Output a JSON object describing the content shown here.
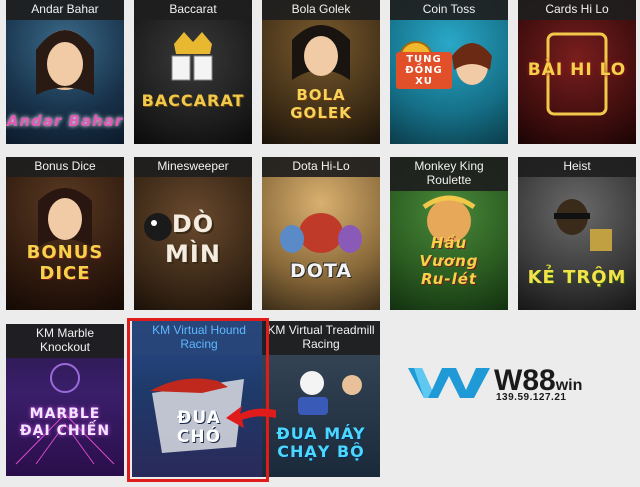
{
  "games": [
    {
      "label": "Andar Bahar",
      "logo": "Andar Bahar"
    },
    {
      "label": "Baccarat",
      "logo": "BACCARAT"
    },
    {
      "label": "Bola Golek",
      "logo": "BOLA GOLEK"
    },
    {
      "label": "Coin Toss",
      "logo": "TUNG ĐỒNG XU"
    },
    {
      "label": "Cards Hi Lo",
      "logo": "BÀI HI LO"
    },
    {
      "label": "Bonus Dice",
      "logo": "BONUS DICE"
    },
    {
      "label": "Minesweeper",
      "logo": "DÒ MÌN"
    },
    {
      "label": "Dota Hi-Lo",
      "logo": "DOTA"
    },
    {
      "label": "Monkey King Roulette",
      "logo": "Hầu Vương Ru-lét"
    },
    {
      "label": "Heist",
      "logo": "KẺ TRỘM"
    },
    {
      "label": "KM Marble Knockout",
      "logo": "MARBLE ĐẠI CHIẾN"
    },
    {
      "label": "KM Virtual Hound Racing",
      "logo": "ĐUA CHÓ"
    },
    {
      "label": "KM Virtual Treadmill Racing",
      "logo": "ĐUA MÁY CHẠY BỘ"
    }
  ],
  "brand": {
    "name": "W88",
    "suffix": "win",
    "ip": "139.59.127.21"
  },
  "colors": {
    "highlight": "#e01b1b",
    "brand_blue": "#1f9ad6",
    "label_bg": "#1e1e1e"
  },
  "icons": {
    "arrow": "red-arrow-icon",
    "brand_mark": "w88-logo-icon"
  }
}
